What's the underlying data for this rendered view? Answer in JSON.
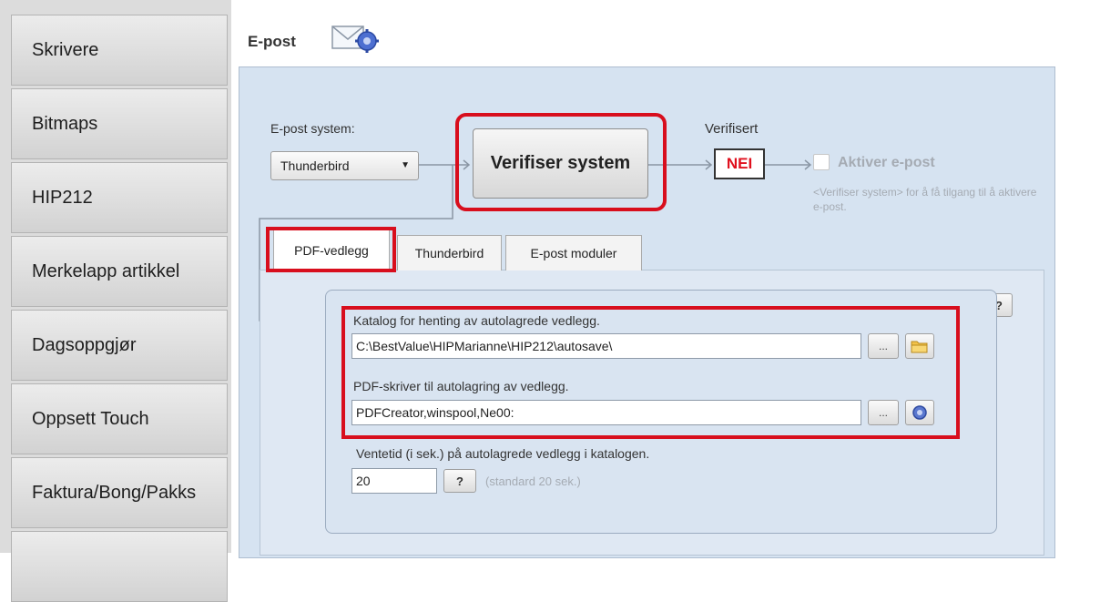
{
  "sidebar": {
    "items": [
      {
        "label": "Skrivere"
      },
      {
        "label": "Bitmaps"
      },
      {
        "label": "HIP212"
      },
      {
        "label": "Merkelapp artikkel"
      },
      {
        "label": "Dagsoppgjør"
      },
      {
        "label": "Oppsett Touch"
      },
      {
        "label": "Faktura/Bong/Pakks"
      }
    ]
  },
  "header": {
    "title": "E-post",
    "icon": "mail-settings-icon"
  },
  "email": {
    "system_label": "E-post system:",
    "system_value": "Thunderbird",
    "verify_button": "Verifiser system",
    "verified_label": "Verifisert",
    "verified_value": "NEI",
    "activate_label": "Aktiver e-post",
    "activate_hint": "<Verifiser system> for å få tilgang til å aktivere e-post."
  },
  "tabs": [
    {
      "label": "PDF-vedlegg",
      "active": true
    },
    {
      "label": "Thunderbird",
      "active": false
    },
    {
      "label": "E-post moduler",
      "active": false
    }
  ],
  "pdf": {
    "help_label": "?",
    "catalog_label": "Katalog for henting av autolagrede vedlegg.",
    "catalog_value": "C:\\BestValue\\HIPMarianne\\HIP212\\autosave\\",
    "printer_label": "PDF-skriver til autolagring av vedlegg.",
    "printer_value": "PDFCreator,winspool,Ne00:",
    "browse_label": "...",
    "wait_label": "Ventetid (i sek.) på autolagrede vedlegg i katalogen.",
    "wait_value": "20",
    "wait_help": "?",
    "wait_hint": "(standard 20 sek.)"
  },
  "colors": {
    "highlight": "#d80e1d",
    "panel": "#d6e3f1",
    "nei": "#e0101e",
    "disabled_text": "#a5abb3"
  }
}
